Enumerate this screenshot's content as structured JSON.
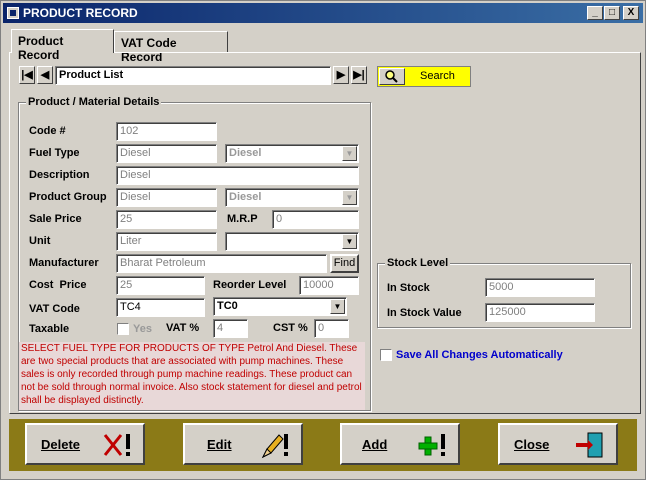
{
  "window": {
    "title": "PRODUCT RECORD",
    "min": "_",
    "max": "□",
    "close": "X"
  },
  "tabs": [
    {
      "label": "Product Record"
    },
    {
      "label": "VAT Code Record"
    }
  ],
  "nav": {
    "list_label": "Product List",
    "first": "|◀",
    "prev": "◀",
    "next": "▶",
    "last": "▶|",
    "search_label": "Search"
  },
  "details": {
    "group_title": "Product / Material Details",
    "code_label": "Code #",
    "code_value": "102",
    "fuel_label": "Fuel Type",
    "fuel_value": "Diesel",
    "fuel_combo": "Diesel",
    "desc_label": "Description",
    "desc_value": "Diesel",
    "group_label": "Product Group",
    "group_value": "Diesel",
    "group_combo": "Diesel",
    "sale_label": "Sale Price",
    "sale_value": "25",
    "mrp_label": "M.R.P",
    "mrp_value": "0",
    "unit_label": "Unit",
    "unit_value": "Liter",
    "unit_combo": "",
    "mfr_label": "Manufacturer",
    "mfr_value": "Bharat Petroleum",
    "find_label": "Find",
    "cost_label": "Cost  Price",
    "cost_value": "25",
    "reorder_label": "Reorder Level",
    "reorder_value": "10000",
    "vat_label": "VAT Code",
    "vat_value": "TC4",
    "vat_combo": "TC0",
    "taxable_label": "Taxable",
    "yes_label": "Yes",
    "vatpct_label": "VAT %",
    "vatpct_value": "4",
    "cstpct_label": "CST %",
    "cstpct_value": "0"
  },
  "note": "SELECT FUEL TYPE FOR PRODUCTS OF TYPE Petrol And Diesel. These are two special products that are associated with pump machines. These sales is only recorded through pump machine readings. These product can not be sold through normal invoice. Also stock statement for diesel and petrol shall be displayed distinctly.",
  "stock": {
    "group_title": "Stock Level",
    "instock_label": "In Stock",
    "instock_value": "5000",
    "instockval_label": "In Stock Value",
    "instockval_value": "125000"
  },
  "autosave_label": "Save All Changes Automatically",
  "actions": {
    "delete": "Delete",
    "edit": "Edit",
    "add": "Add",
    "close": "Close"
  },
  "colors": {
    "title_bar": "#0a246a",
    "search_bg": "#ffff00",
    "bottom_bar": "#8b7a17",
    "note_text": "#c00000",
    "link_blue": "#0000cc"
  }
}
